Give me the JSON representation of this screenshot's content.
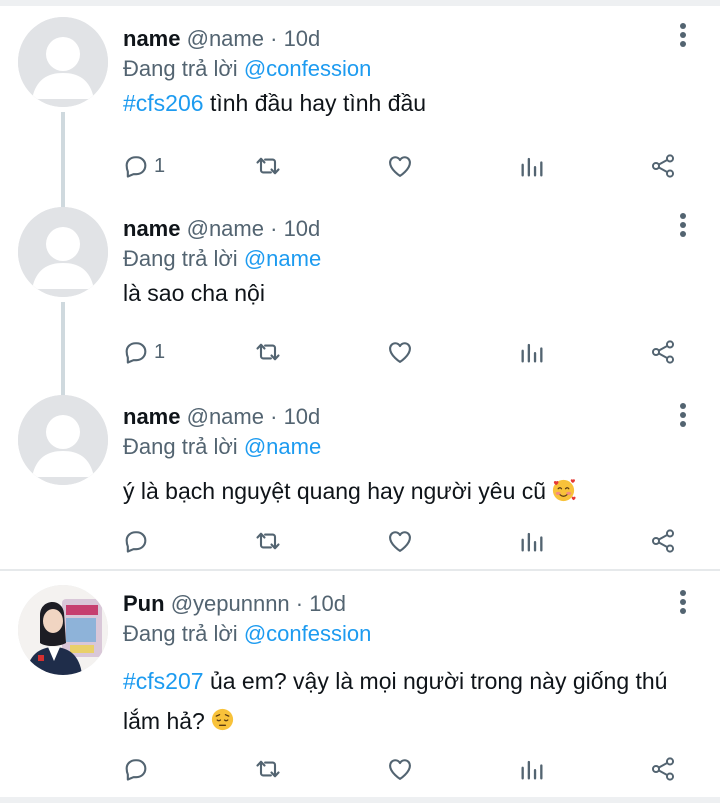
{
  "tweets": [
    {
      "name": "name",
      "handle": "@name",
      "dot": "·",
      "time": "10d",
      "reply_prefix": "Đang trả lời",
      "reply_to": "@confession",
      "hashtag": "#cfs206",
      "text": " tình đầu hay tình đầu",
      "reply_count": "1"
    },
    {
      "name": "name",
      "handle": "@name",
      "dot": "·",
      "time": "10d",
      "reply_prefix": "Đang trả lời",
      "reply_to": "@name",
      "hashtag": "",
      "text": "là sao cha nội",
      "reply_count": "1"
    },
    {
      "name": "name",
      "handle": "@name",
      "dot": "·",
      "time": "10d",
      "reply_prefix": "Đang trả lời",
      "reply_to": "@name",
      "hashtag": "",
      "text": "ý là bạch nguyệt quang hay người yêu cũ",
      "emoji": "smiling-face-with-hearts",
      "reply_count": ""
    },
    {
      "name": "Pun",
      "handle": "@yepunnnn",
      "dot": "·",
      "time": "10d",
      "reply_prefix": "Đang trả lời",
      "reply_to": "@confession",
      "hashtag": "#cfs207",
      "text": " ủa em? vậy là mọi người trong này giống thú lắm hả?",
      "emoji": "pensive-face",
      "reply_count": ""
    }
  ],
  "colors": {
    "accent": "#1d9bf0",
    "secondary_text": "#536471",
    "icon": "#536471"
  }
}
